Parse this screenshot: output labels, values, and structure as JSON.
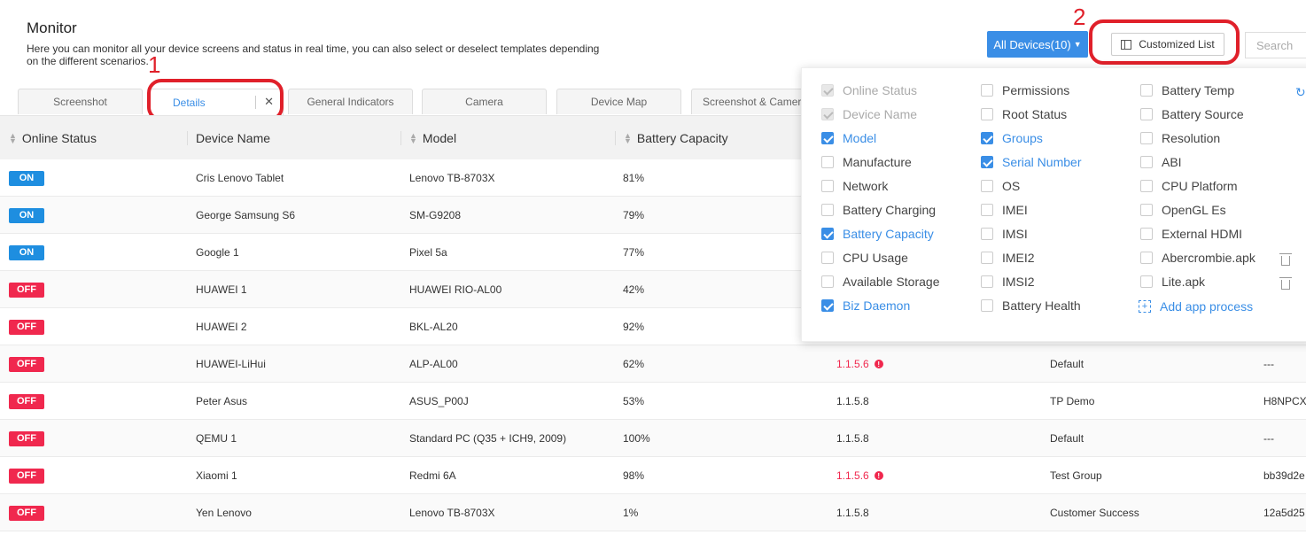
{
  "header": {
    "title": "Monitor",
    "description": "Here you can monitor all your device screens and status in real time, you can also select or deselect templates depending on the different scenarios."
  },
  "tabs": [
    "Screenshot",
    "Details",
    "General Indicators",
    "Camera",
    "Device Map",
    "Screenshot & Camera"
  ],
  "active_tab": "Details",
  "toolbar": {
    "all_devices_label": "All Devices(10)",
    "customized_list_label": "Customized List",
    "search_placeholder": "Search"
  },
  "annotations": [
    "1",
    "2"
  ],
  "table": {
    "columns": [
      "Online Status",
      "Device Name",
      "Model",
      "Battery Capacity"
    ],
    "rows": [
      {
        "status": "ON",
        "name": "Cris Lenovo Tablet",
        "model": "Lenovo TB-8703X",
        "battery": "81%",
        "version": "",
        "group": "",
        "serial": ""
      },
      {
        "status": "ON",
        "name": "George Samsung S6",
        "model": "SM-G9208",
        "battery": "79%",
        "version": "",
        "group": "",
        "serial": ""
      },
      {
        "status": "ON",
        "name": "Google 1",
        "model": "Pixel 5a",
        "battery": "77%",
        "version": "",
        "group": "",
        "serial": ""
      },
      {
        "status": "OFF",
        "name": "HUAWEI 1",
        "model": "HUAWEI RIO-AL00",
        "battery": "42%",
        "version": "",
        "group": "",
        "serial": ""
      },
      {
        "status": "OFF",
        "name": "HUAWEI 2",
        "model": "BKL-AL20",
        "battery": "92%",
        "version": "",
        "group": "",
        "serial": ""
      },
      {
        "status": "OFF",
        "name": "HUAWEI-LiHui",
        "model": "ALP-AL00",
        "battery": "62%",
        "version": "1.1.5.6",
        "version_warn": true,
        "group": "Default",
        "serial": "---"
      },
      {
        "status": "OFF",
        "name": "Peter Asus",
        "model": "ASUS_P00J",
        "battery": "53%",
        "version": "1.1.5.8",
        "version_warn": false,
        "group": "TP Demo",
        "serial": "H8NPCX"
      },
      {
        "status": "OFF",
        "name": "QEMU 1",
        "model": "Standard PC (Q35 + ICH9, 2009)",
        "battery": "100%",
        "version": "1.1.5.8",
        "version_warn": false,
        "group": "Default",
        "serial": "---"
      },
      {
        "status": "OFF",
        "name": "Xiaomi 1",
        "model": "Redmi 6A",
        "battery": "98%",
        "version": "1.1.5.6",
        "version_warn": true,
        "group": "Test Group",
        "serial": "bb39d2e"
      },
      {
        "status": "OFF",
        "name": "Yen Lenovo",
        "model": "Lenovo TB-8703X",
        "battery": "1%",
        "version": "1.1.5.8",
        "version_warn": false,
        "group": "Customer Success",
        "serial": "12a5d25"
      }
    ]
  },
  "customize_panel": {
    "columns": [
      [
        {
          "label": "Online Status",
          "state": "disabled"
        },
        {
          "label": "Device Name",
          "state": "disabled"
        },
        {
          "label": "Model",
          "state": "checked"
        },
        {
          "label": "Manufacture",
          "state": "unchecked"
        },
        {
          "label": "Network",
          "state": "unchecked"
        },
        {
          "label": "Battery Charging",
          "state": "unchecked"
        },
        {
          "label": "Battery Capacity",
          "state": "checked"
        },
        {
          "label": "CPU Usage",
          "state": "unchecked"
        },
        {
          "label": "Available Storage",
          "state": "unchecked"
        },
        {
          "label": "Biz Daemon",
          "state": "checked"
        }
      ],
      [
        {
          "label": "Permissions",
          "state": "unchecked"
        },
        {
          "label": "Root Status",
          "state": "unchecked"
        },
        {
          "label": "Groups",
          "state": "checked"
        },
        {
          "label": "Serial Number",
          "state": "checked"
        },
        {
          "label": "OS",
          "state": "unchecked"
        },
        {
          "label": "IMEI",
          "state": "unchecked"
        },
        {
          "label": "IMSI",
          "state": "unchecked"
        },
        {
          "label": "IMEI2",
          "state": "unchecked"
        },
        {
          "label": "IMSI2",
          "state": "unchecked"
        },
        {
          "label": "Battery Health",
          "state": "unchecked"
        }
      ],
      [
        {
          "label": "Battery Temp",
          "state": "unchecked"
        },
        {
          "label": "Battery Source",
          "state": "unchecked"
        },
        {
          "label": "Resolution",
          "state": "unchecked"
        },
        {
          "label": "ABI",
          "state": "unchecked"
        },
        {
          "label": "CPU Platform",
          "state": "unchecked"
        },
        {
          "label": "OpenGL Es",
          "state": "unchecked"
        },
        {
          "label": "External HDMI",
          "state": "unchecked"
        },
        {
          "label": "Abercrombie.apk",
          "state": "unchecked",
          "deletable": true
        },
        {
          "label": "Lite.apk",
          "state": "unchecked",
          "deletable": true
        }
      ]
    ],
    "add_process_label": "Add app process"
  },
  "colors": {
    "accent": "#3a8ee6",
    "on": "#1e8ee0",
    "off": "#f0284e",
    "annotation": "#e0202a"
  }
}
